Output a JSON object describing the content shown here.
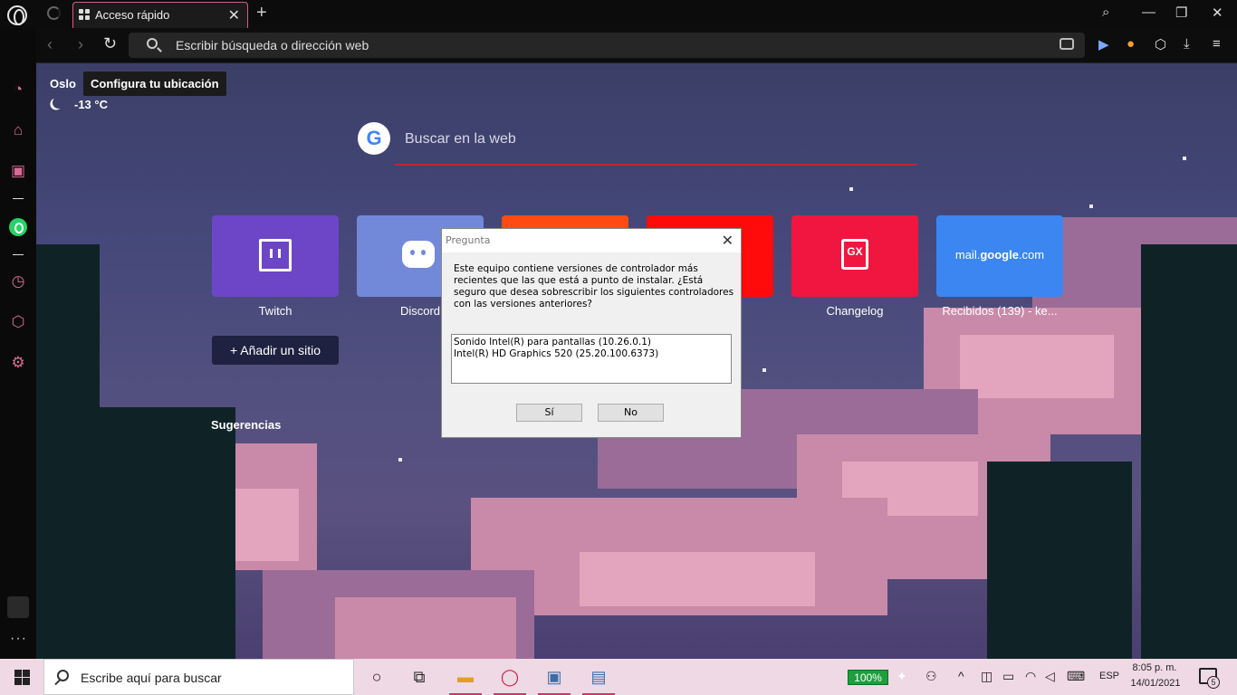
{
  "browser": {
    "tab_title": "Acceso rápido",
    "address_placeholder": "Escribir búsqueda o dirección web"
  },
  "weather": {
    "city": "Oslo",
    "tooltip": "Configura tu ubicación",
    "temperature": "-13 °C"
  },
  "search": {
    "placeholder": "Buscar en la web"
  },
  "speed_dial": [
    {
      "label": "Twitch",
      "color": "#6d46c7"
    },
    {
      "label": "Discord",
      "color": "#7289da"
    },
    {
      "label": "",
      "color": "#ff4a14"
    },
    {
      "label": "",
      "color": "#ff0b0b"
    },
    {
      "label": "Changelog",
      "color": "#f0163f"
    },
    {
      "label": "Recibidos (139) - ke...",
      "color": "#3b86f0",
      "tile_text_host": "mail.",
      "tile_text_bold": "google",
      "tile_text_tld": ".com"
    }
  ],
  "add_site_label": "+ Añadir un sitio",
  "suggestions_label": "Sugerencias",
  "dialog": {
    "title": "Pregunta",
    "message": "Este equipo contiene versiones de controlador más recientes que las que está a punto de instalar. ¿Está seguro que desea sobrescribir los siguientes controladores con las versiones anteriores?",
    "items": [
      "Sonido Intel(R) para pantallas (10.26.0.1)",
      "Intel(R) HD Graphics 520 (25.20.100.6373)"
    ],
    "yes_label": "Sí",
    "no_label": "No"
  },
  "taskbar": {
    "search_placeholder": "Escribe aquí para buscar",
    "battery": "100%",
    "language": "ESP",
    "time": "8:05 p. m.",
    "date": "14/01/2021",
    "notifications": "5"
  }
}
